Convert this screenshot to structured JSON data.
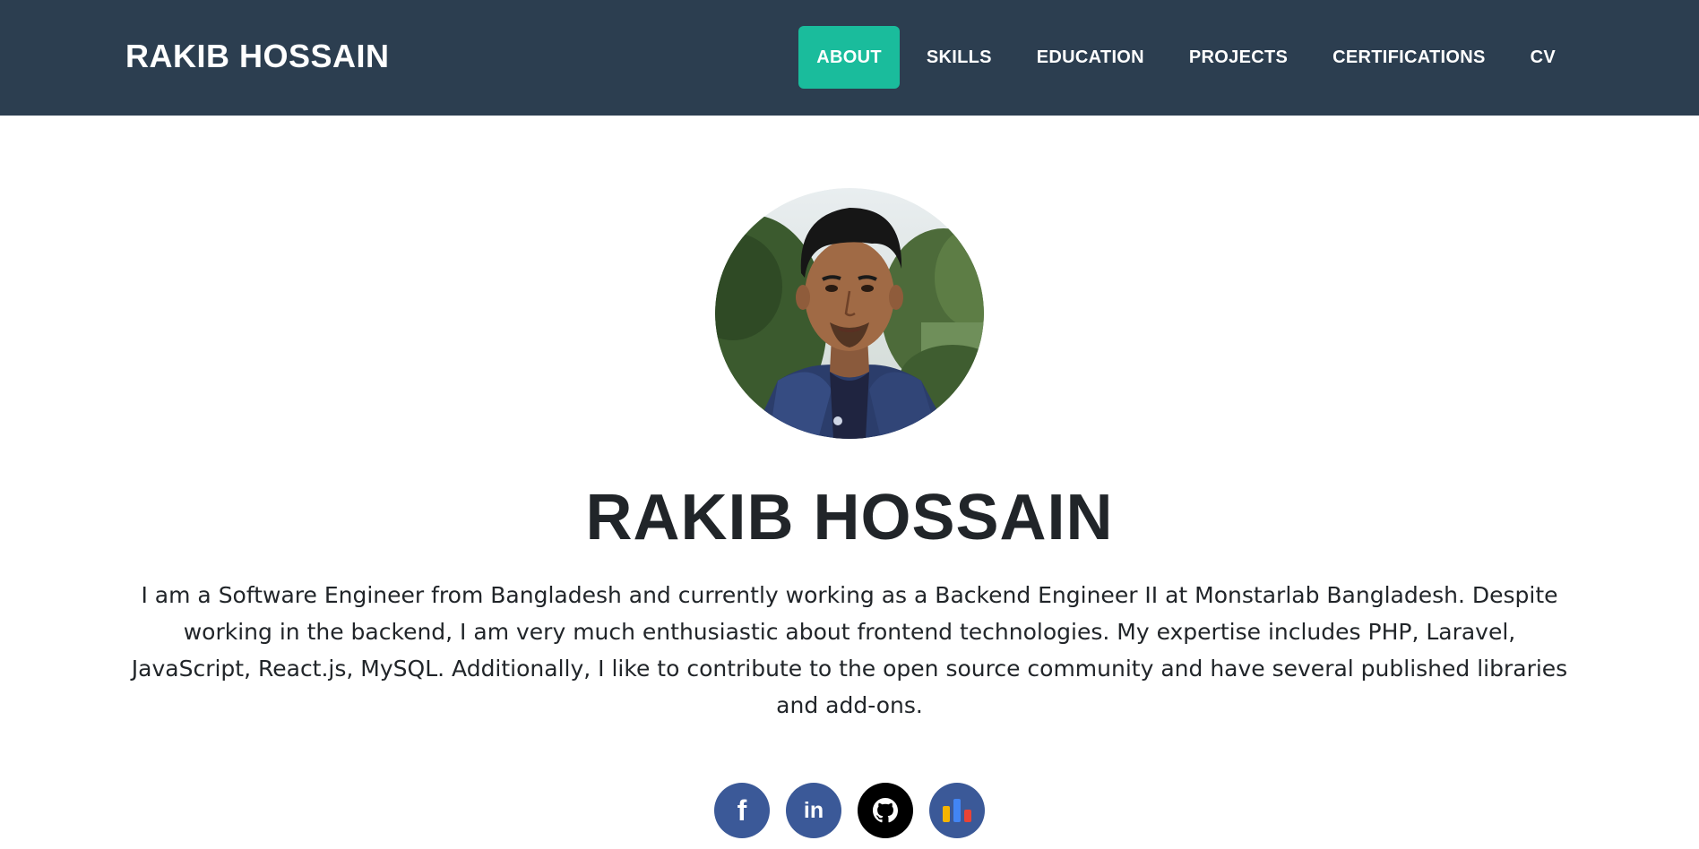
{
  "brand": "RAKIB HOSSAIN",
  "nav": {
    "items": [
      {
        "label": "ABOUT",
        "active": true
      },
      {
        "label": "SKILLS"
      },
      {
        "label": "EDUCATION"
      },
      {
        "label": "PROJECTS"
      },
      {
        "label": "CERTIFICATIONS"
      },
      {
        "label": "CV"
      }
    ]
  },
  "hero": {
    "name": "RAKIB HOSSAIN",
    "bio": "I am a Software Engineer from Bangladesh and currently working as a Backend Engineer II at Monstarlab Bangladesh. Despite working in the backend, I am very much enthusiastic about frontend technologies. My expertise includes PHP, Laravel, JavaScript, React.js, MySQL. Additionally, I like to contribute to the open source community and have several published libraries and add-ons."
  },
  "socials": [
    {
      "icon": "facebook-icon",
      "glyph": "f"
    },
    {
      "icon": "linkedin-icon",
      "glyph": "in"
    },
    {
      "icon": "github-icon"
    },
    {
      "icon": "stats-icon"
    }
  ],
  "colors": {
    "navbar": "#2c3e50",
    "accent": "#1abc9c",
    "social_blue": "#3b5998",
    "github": "#000000"
  }
}
